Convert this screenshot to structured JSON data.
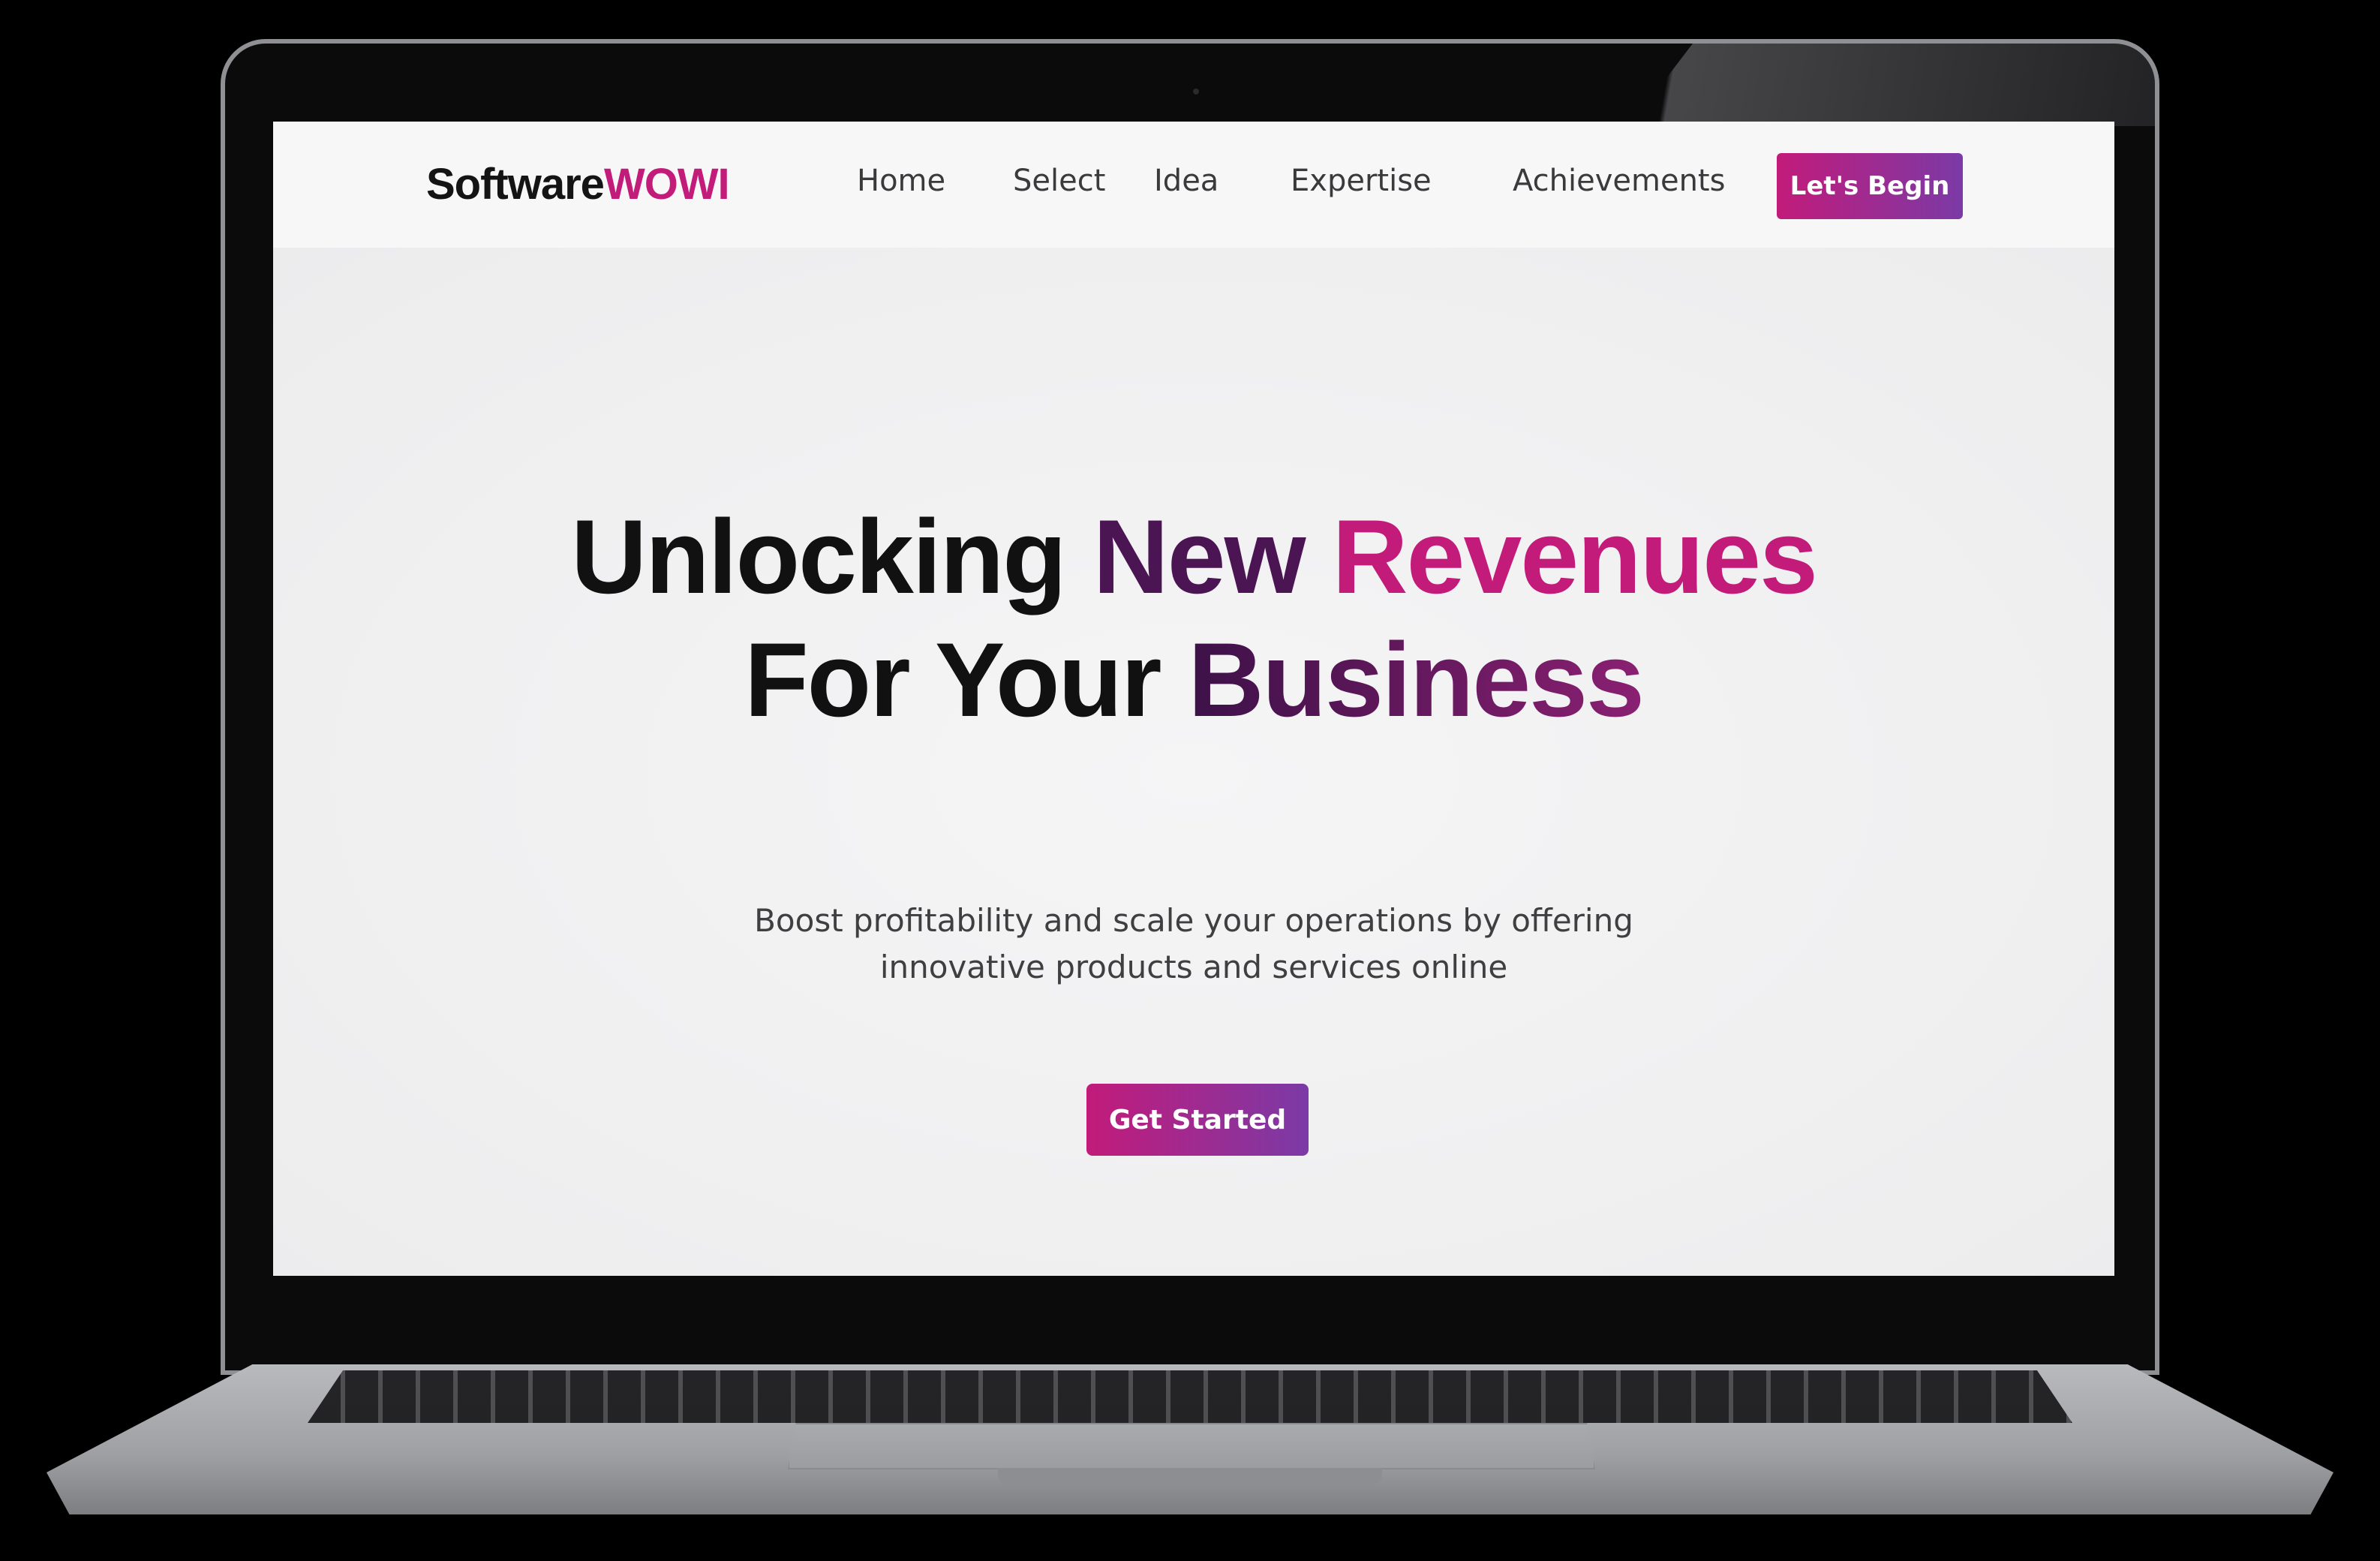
{
  "brand": {
    "logo_main": "Software",
    "logo_accent": "WOWI",
    "accent_color": "#c21b7a",
    "gradient_end_color": "#7b3aa6"
  },
  "nav": {
    "links": [
      {
        "label": "Home"
      },
      {
        "label": "Select"
      },
      {
        "label": "Idea"
      },
      {
        "label": "Expertise"
      },
      {
        "label": "Achievements"
      }
    ],
    "cta_label": "Let's Begin"
  },
  "hero": {
    "title_word_1": "Unlocking",
    "title_word_2": "New",
    "title_word_3": "Revenues",
    "title_line2_plain": "For Your",
    "title_line2_accent": "Business",
    "subtitle_line1": "Boost profitability and scale your operations by offering",
    "subtitle_line2": "innovative products and services online",
    "cta_label": "Get Started"
  }
}
